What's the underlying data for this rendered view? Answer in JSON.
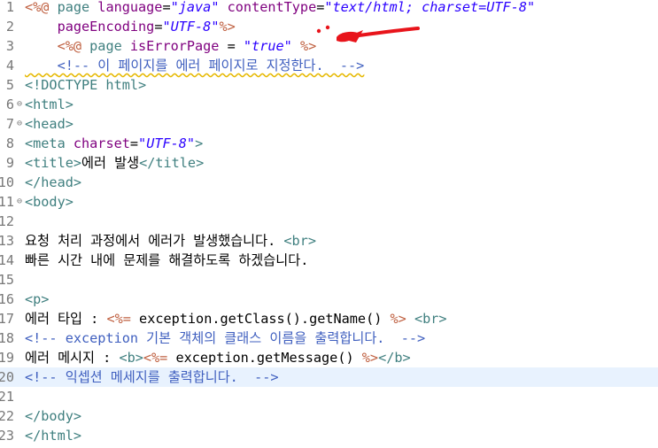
{
  "editor": {
    "lines": [
      {
        "n": "1",
        "fold": "",
        "segs": [
          [
            "delim",
            "<%@ "
          ],
          [
            "kw",
            "page "
          ],
          [
            "attr",
            "language"
          ],
          [
            "txt",
            "="
          ],
          [
            "str",
            "\"java\""
          ],
          [
            "txt",
            " "
          ],
          [
            "attr",
            "contentType"
          ],
          [
            "txt",
            "="
          ],
          [
            "str",
            "\"text/html; charset=UTF-8\""
          ]
        ]
      },
      {
        "n": "2",
        "fold": "",
        "segs": [
          [
            "txt",
            "    "
          ],
          [
            "attr",
            "pageEncoding"
          ],
          [
            "txt",
            "="
          ],
          [
            "str",
            "\"UTF-8\""
          ],
          [
            "delim",
            "%>"
          ]
        ]
      },
      {
        "n": "3",
        "fold": "",
        "segs": [
          [
            "txt",
            "    "
          ],
          [
            "delim",
            "<%@ "
          ],
          [
            "kw",
            "page "
          ],
          [
            "attr",
            "isErrorPage"
          ],
          [
            "txt",
            " = "
          ],
          [
            "str",
            "\"true\""
          ],
          [
            "txt",
            " "
          ],
          [
            "delim",
            "%>"
          ]
        ]
      },
      {
        "n": "4",
        "fold": "",
        "warn": true,
        "segs": [
          [
            "txt",
            "    "
          ],
          [
            "cmt",
            "<!-- 이 페이지를 에러 페이지로 지정한다.  -->"
          ]
        ]
      },
      {
        "n": "5",
        "fold": "",
        "segs": [
          [
            "tag",
            "<!DOCTYPE html>"
          ]
        ]
      },
      {
        "n": "6",
        "fold": "⊖",
        "segs": [
          [
            "tag",
            "<html>"
          ]
        ]
      },
      {
        "n": "7",
        "fold": "⊖",
        "segs": [
          [
            "tag",
            "<head>"
          ]
        ]
      },
      {
        "n": "8",
        "fold": "",
        "segs": [
          [
            "tag",
            "<meta "
          ],
          [
            "attr",
            "charset"
          ],
          [
            "txt",
            "="
          ],
          [
            "str",
            "\"UTF-8\""
          ],
          [
            "tag",
            ">"
          ]
        ]
      },
      {
        "n": "9",
        "fold": "",
        "segs": [
          [
            "tag",
            "<title>"
          ],
          [
            "txt",
            "에러 발생"
          ],
          [
            "tag",
            "</title>"
          ]
        ]
      },
      {
        "n": "10",
        "fold": "",
        "segs": [
          [
            "tag",
            "</head>"
          ]
        ]
      },
      {
        "n": "11",
        "fold": "⊖",
        "segs": [
          [
            "tag",
            "<body>"
          ]
        ]
      },
      {
        "n": "12",
        "fold": "",
        "segs": []
      },
      {
        "n": "13",
        "fold": "",
        "segs": [
          [
            "txt",
            "요청 처리 과정에서 에러가 발생했습니다. "
          ],
          [
            "tag",
            "<br>"
          ]
        ]
      },
      {
        "n": "14",
        "fold": "",
        "segs": [
          [
            "txt",
            "빠른 시간 내에 문제를 해결하도록 하겠습니다."
          ]
        ]
      },
      {
        "n": "15",
        "fold": "",
        "segs": []
      },
      {
        "n": "16",
        "fold": "",
        "segs": [
          [
            "tag",
            "<p>"
          ]
        ]
      },
      {
        "n": "17",
        "fold": "",
        "segs": [
          [
            "txt",
            "에러 타입 : "
          ],
          [
            "delim",
            "<%="
          ],
          [
            "java",
            " exception.getClass().getName() "
          ],
          [
            "delim",
            "%>"
          ],
          [
            "txt",
            " "
          ],
          [
            "tag",
            "<br>"
          ]
        ]
      },
      {
        "n": "18",
        "fold": "",
        "segs": [
          [
            "cmt",
            "<!-- exception 기본 객체의 클래스 이름을 출력합니다.  -->"
          ]
        ]
      },
      {
        "n": "19",
        "fold": "",
        "segs": [
          [
            "txt",
            "에러 메시지 : "
          ],
          [
            "tag",
            "<b>"
          ],
          [
            "delim",
            "<%="
          ],
          [
            "java",
            " exception.getMessage() "
          ],
          [
            "delim",
            "%>"
          ],
          [
            "tag",
            "</b>"
          ]
        ]
      },
      {
        "n": "20",
        "fold": "",
        "current": true,
        "segs": [
          [
            "cmt",
            "<!-- 익셉션 메세지를 출력합니다.  -->"
          ]
        ]
      },
      {
        "n": "21",
        "fold": "",
        "segs": []
      },
      {
        "n": "22",
        "fold": "",
        "segs": [
          [
            "tag",
            "</body>"
          ]
        ]
      },
      {
        "n": "23",
        "fold": "",
        "segs": [
          [
            "tag",
            "</html>"
          ]
        ]
      }
    ]
  },
  "colors": {
    "tag": "#3f7f7f",
    "jsp_delimiter": "#bf5f3f",
    "attribute": "#7f007f",
    "string": "#2a00ff",
    "comment": "#3f5fbf",
    "current_line": "#e8f2fe",
    "annotation": "#e8141b"
  },
  "annotation": {
    "icon": "red-hand-drawn-arrow"
  }
}
